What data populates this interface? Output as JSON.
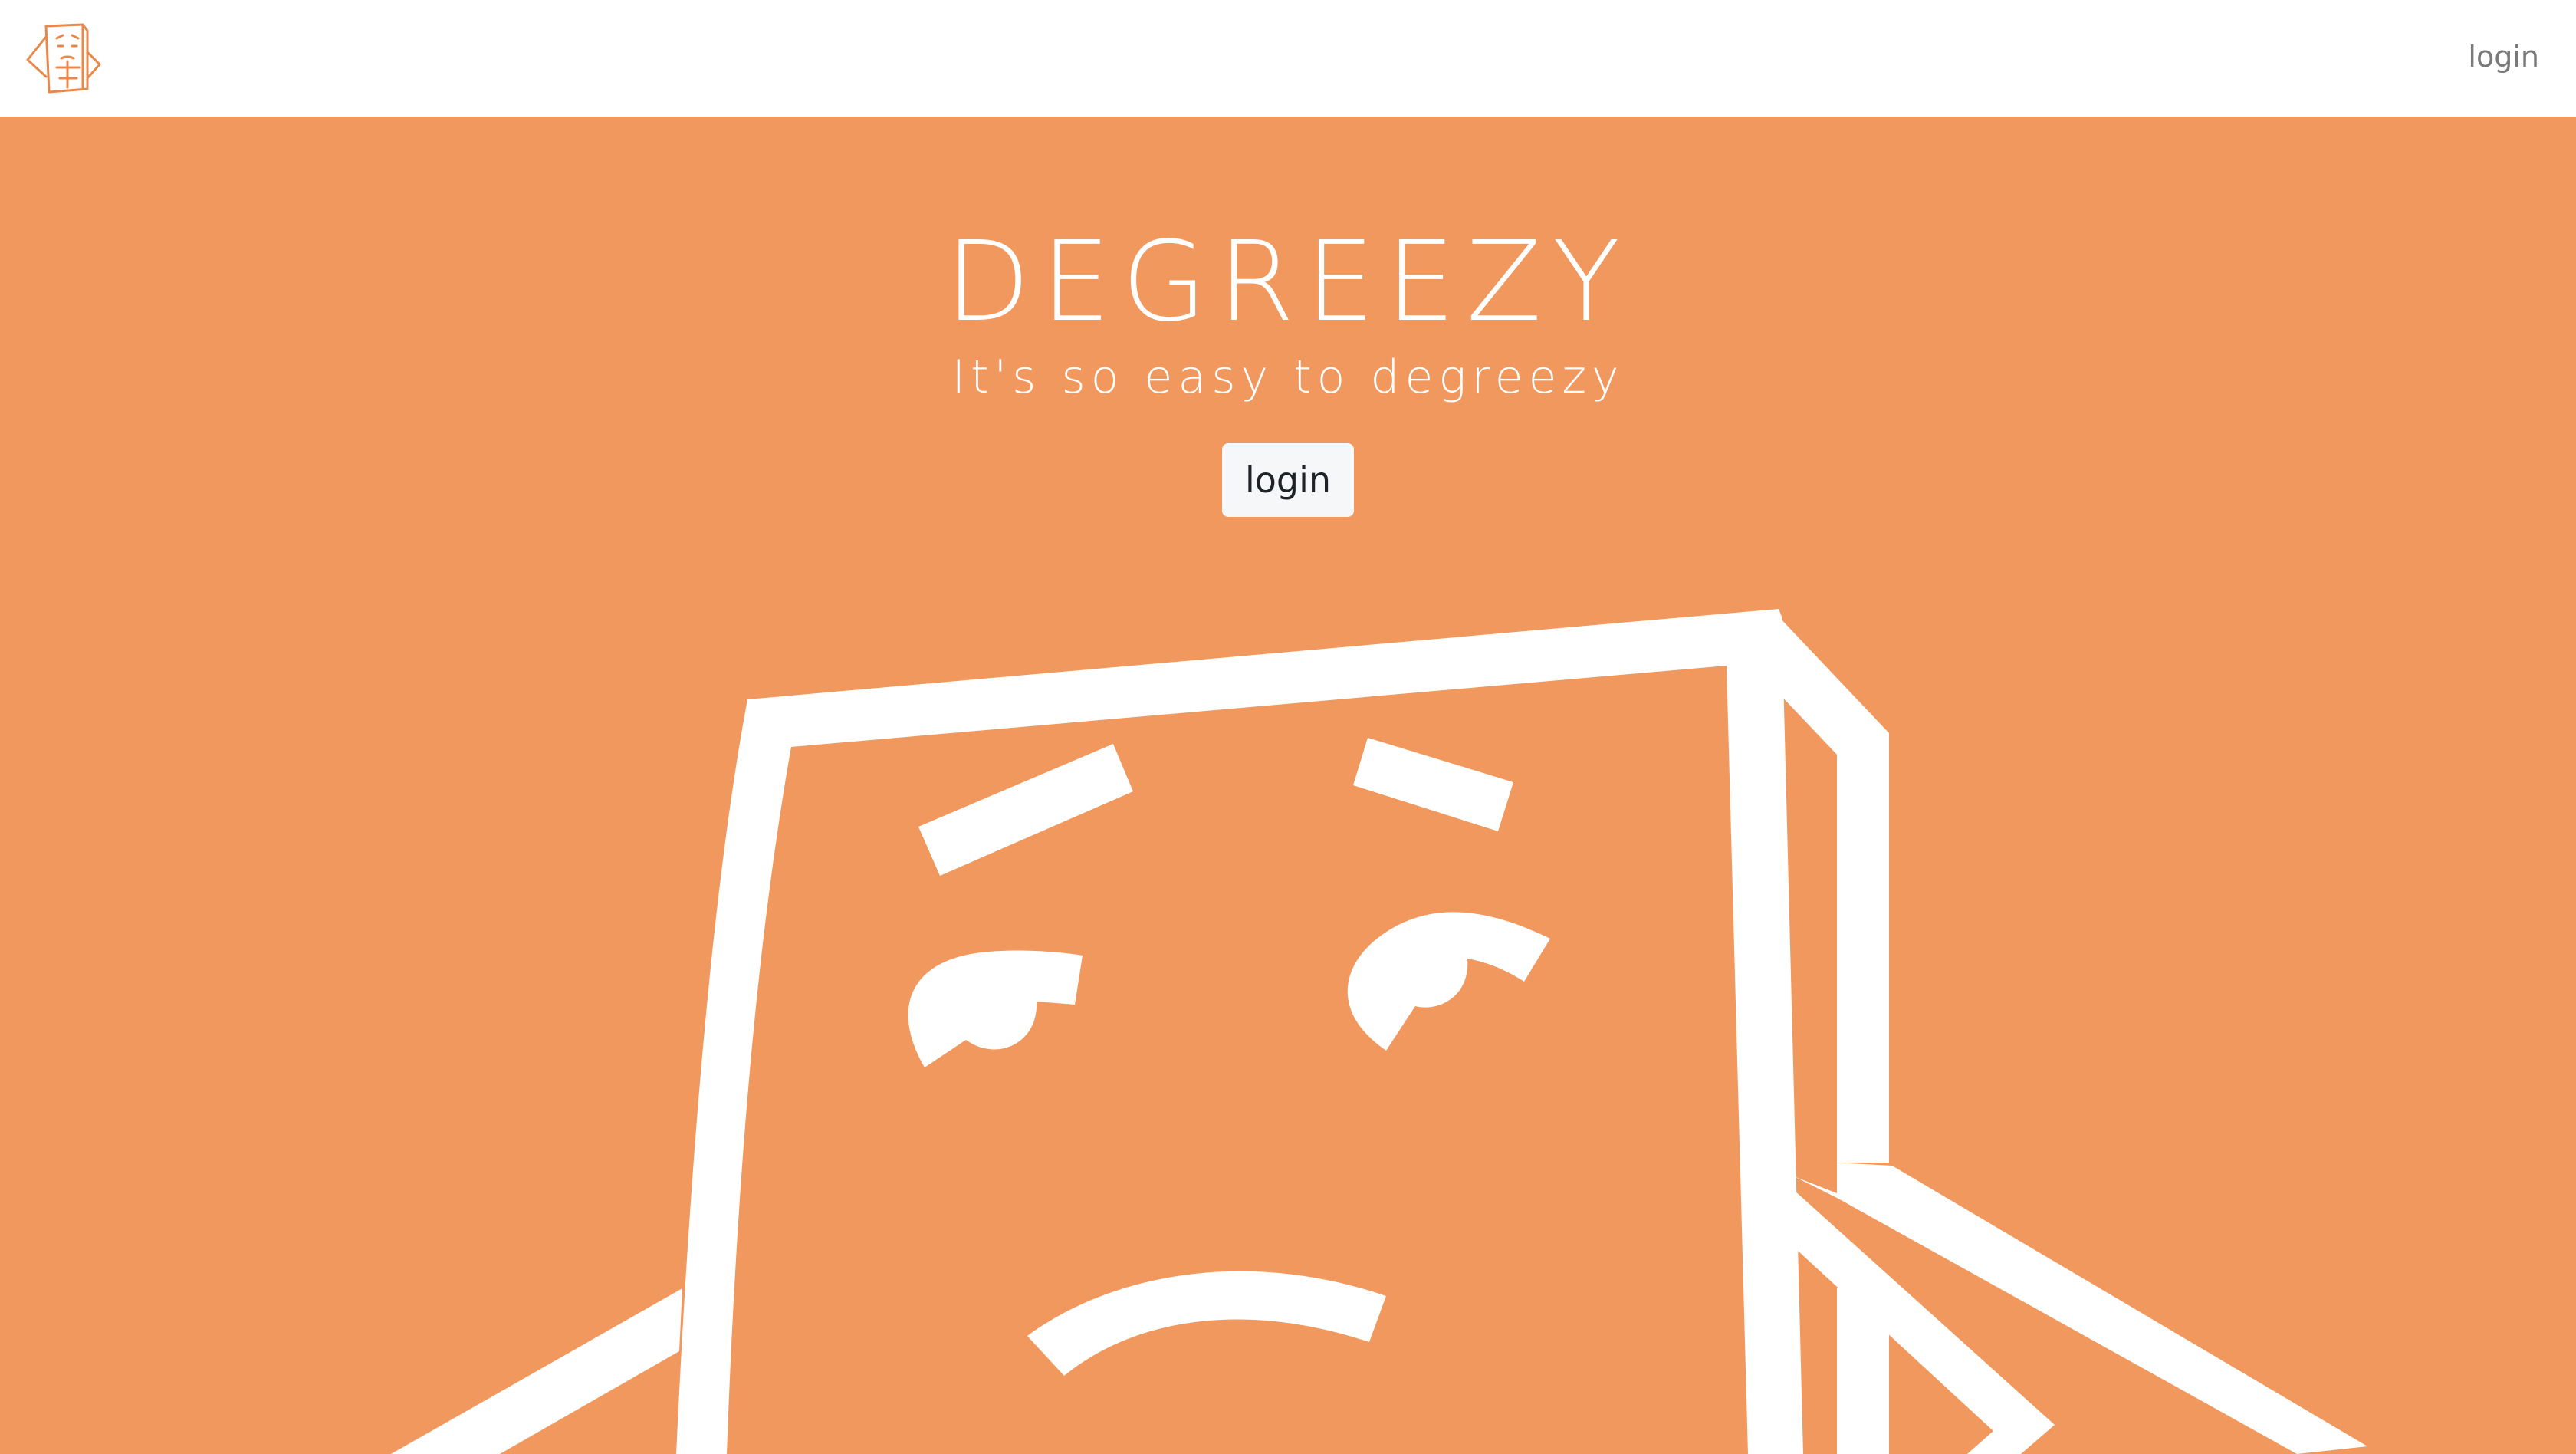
{
  "header": {
    "logo_icon": "degreezy-logo-icon",
    "login_label": "login"
  },
  "hero": {
    "title": "DEGREEZY",
    "subtitle": "It's so easy to degreezy",
    "login_button_label": "login",
    "illustration_icon": "worried-box-mascot-icon"
  },
  "colors": {
    "hero_background": "#f0985d",
    "logo": "#e8884a",
    "header_background": "#ffffff",
    "nav_text": "#7a7a7a",
    "button_background": "#f6f7f9"
  }
}
